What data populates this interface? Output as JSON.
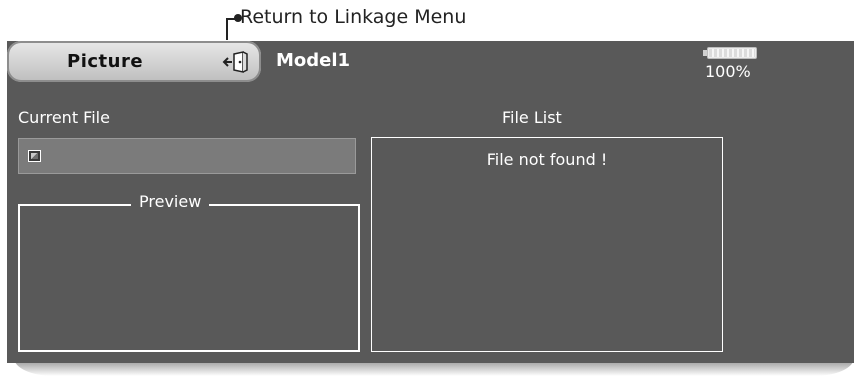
{
  "callout": {
    "text": "Return to Linkage Menu"
  },
  "tab": {
    "label": "Picture"
  },
  "header": {
    "model_name": "Model1"
  },
  "battery": {
    "percent": "100%",
    "level": 1.0
  },
  "current_file": {
    "label": "Current File"
  },
  "preview": {
    "label": "Preview"
  },
  "file_list": {
    "label": "File List",
    "empty_message": "File not found !"
  },
  "icons": {
    "return": "return-door-icon",
    "battery": "battery-icon",
    "file": "picture-file-icon"
  }
}
